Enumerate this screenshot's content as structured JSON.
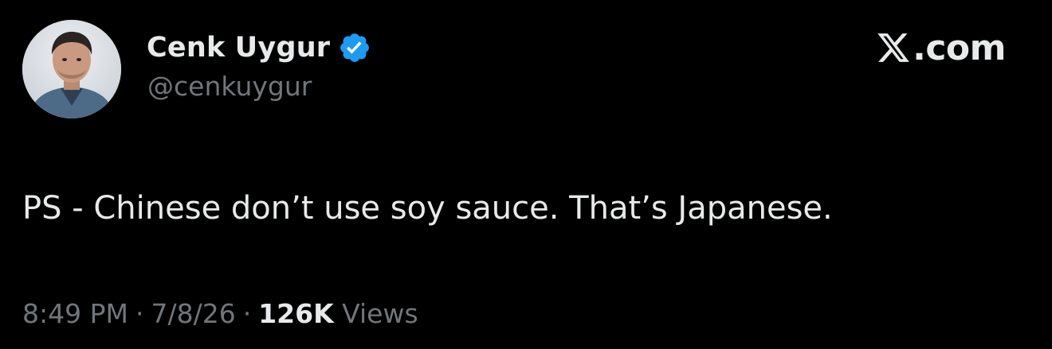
{
  "author": {
    "display_name": "Cenk Uygur",
    "handle": "@cenkuygur",
    "verified": true
  },
  "brand": {
    "text": ".com",
    "logo_icon": "x-logo-icon"
  },
  "tweet": {
    "text": "PS - Chinese don’t use soy sauce. That’s Japanese."
  },
  "meta": {
    "time": "8:49 PM",
    "separator": "·",
    "date": "7/8/26",
    "views_count": "126K",
    "views_label": "Views"
  },
  "colors": {
    "background": "#000000",
    "primary_text": "#e7e9ea",
    "secondary_text": "#71767b",
    "verified_badge": "#1d9bf0"
  }
}
